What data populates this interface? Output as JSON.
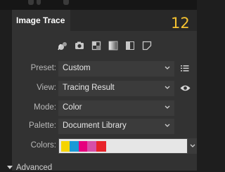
{
  "panel": {
    "tab_label": "Image Trace",
    "step_number": "12"
  },
  "presets": [
    {
      "name": "auto-color-icon"
    },
    {
      "name": "high-color-icon"
    },
    {
      "name": "low-color-icon"
    },
    {
      "name": "grayscale-icon"
    },
    {
      "name": "black-and-white-icon"
    },
    {
      "name": "outline-icon"
    }
  ],
  "fields": {
    "preset": {
      "label": "Preset:",
      "value": "Custom"
    },
    "view": {
      "label": "View:",
      "value": "Tracing Result"
    },
    "mode": {
      "label": "Mode:",
      "value": "Color"
    },
    "palette": {
      "label": "Palette:",
      "value": "Document Library"
    },
    "colors": {
      "label": "Colors:"
    }
  },
  "swatches": [
    "#f5d400",
    "#1a9ad6",
    "#e6007e",
    "#d64fa8",
    "#e8232a"
  ],
  "advanced_label": "Advanced"
}
